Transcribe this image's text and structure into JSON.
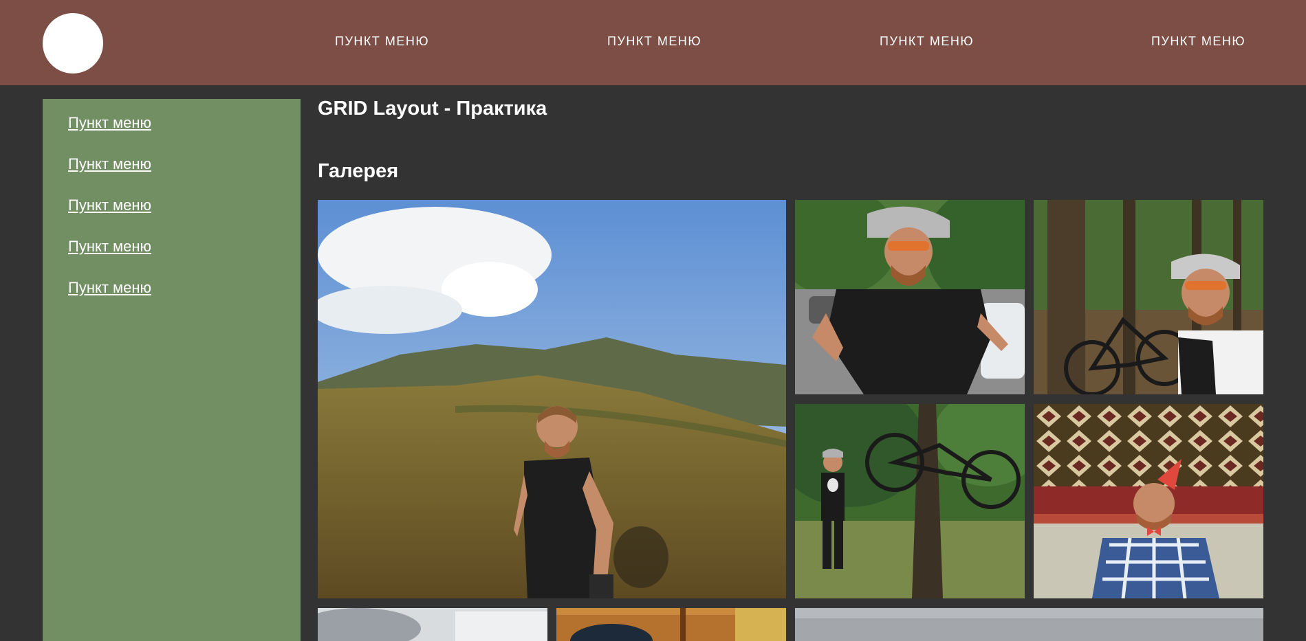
{
  "header": {
    "logo": "logo-circle",
    "nav": [
      "ПУНКТ МЕНЮ",
      "ПУНКТ МЕНЮ",
      "ПУНКТ МЕНЮ",
      "ПУНКТ МЕНЮ"
    ]
  },
  "sidebar": {
    "items": [
      {
        "label": "Пункт меню"
      },
      {
        "label": "Пункт меню"
      },
      {
        "label": "Пункт меню"
      },
      {
        "label": "Пункт меню"
      },
      {
        "label": "Пункт меню"
      }
    ]
  },
  "main": {
    "title": "GRID Layout - Практика",
    "gallery_title": "Галерея"
  },
  "colors": {
    "header": "#7d4e45",
    "sidebar": "#718f62",
    "background": "#333333"
  }
}
